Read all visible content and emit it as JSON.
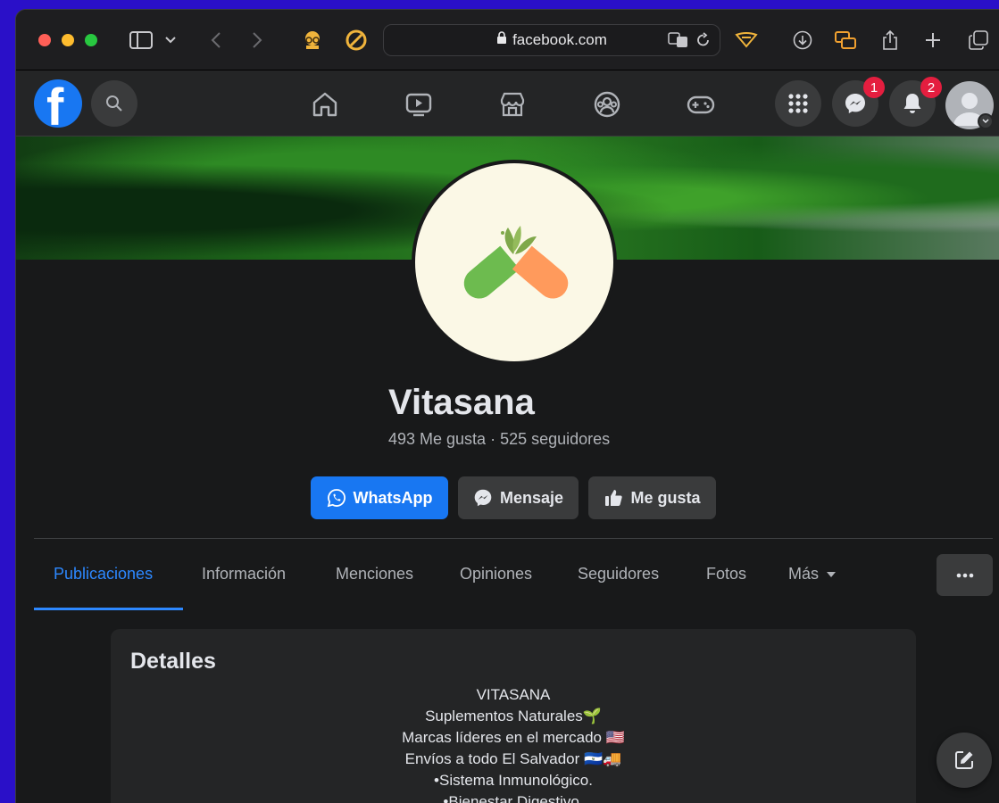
{
  "browser": {
    "url": "facebook.com",
    "colors": {
      "close": "#ff5f57",
      "minimize": "#febc2e",
      "zoom": "#28c840"
    }
  },
  "nav": {
    "messenger_badge": "1",
    "notifications_badge": "2"
  },
  "page": {
    "name": "Vitasana",
    "stats": "493 Me gusta · 525 seguidores"
  },
  "actions": {
    "whatsapp": "WhatsApp",
    "message": "Mensaje",
    "like": "Me gusta"
  },
  "tabs": [
    {
      "label": "Publicaciones",
      "active": true
    },
    {
      "label": "Información"
    },
    {
      "label": "Menciones"
    },
    {
      "label": "Opiniones"
    },
    {
      "label": "Seguidores"
    },
    {
      "label": "Fotos"
    },
    {
      "label": "Más"
    }
  ],
  "details": {
    "title": "Detalles",
    "bio": [
      "VITASANA",
      "Suplementos Naturales🌱",
      "Marcas líderes en el mercado 🇺🇸",
      "Envíos a todo El Salvador 🇸🇻🚚",
      "•Sistema Inmunológico.",
      "•Bienestar Digestivo."
    ]
  },
  "colors": {
    "accent": "#1877f2",
    "link": "#2d88ff",
    "badge": "#e41e3f"
  }
}
